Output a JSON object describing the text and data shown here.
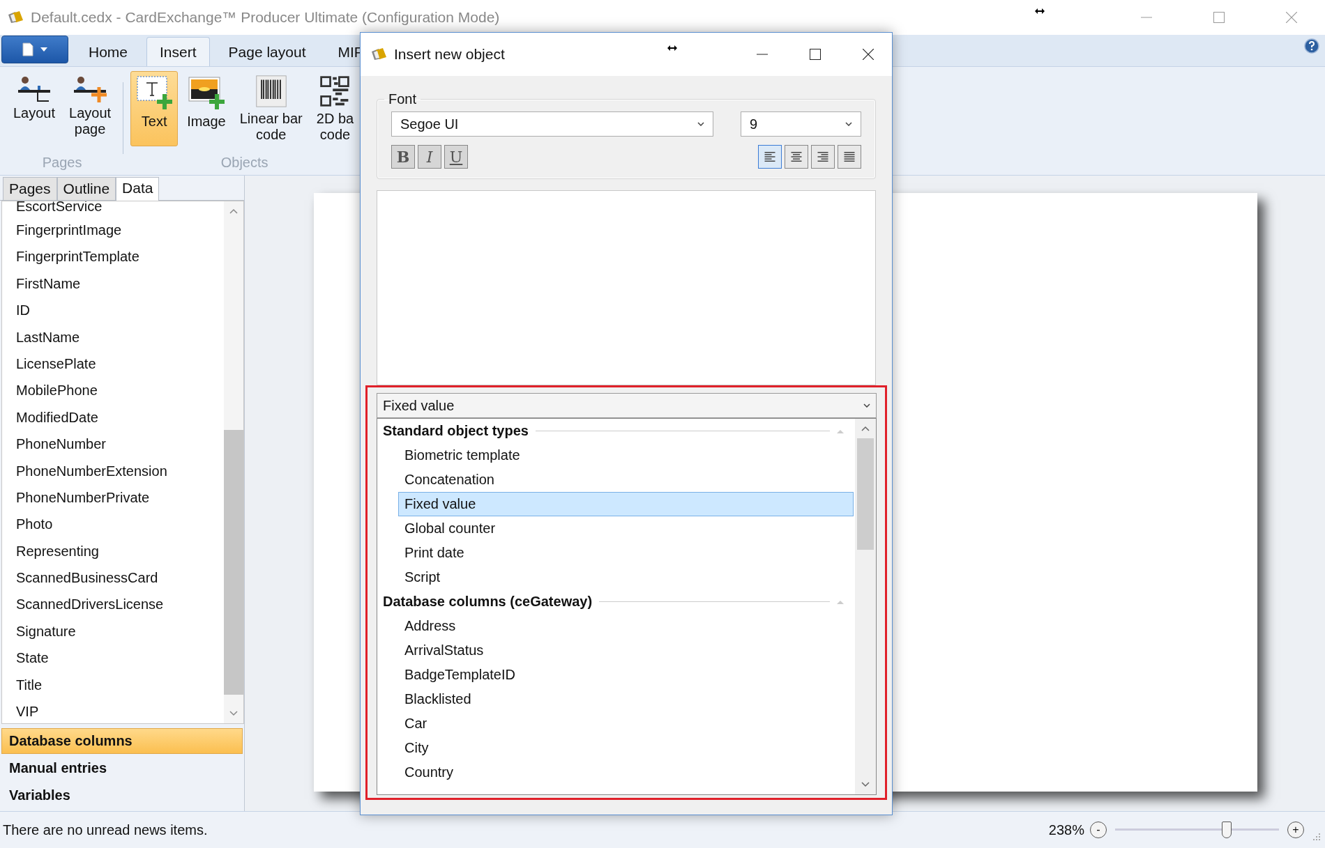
{
  "window": {
    "title": "Default.cedx - CardExchange™ Producer Ultimate (Configuration Mode)"
  },
  "ribbon_tabs": [
    {
      "label": "Home",
      "selected": false
    },
    {
      "label": "Insert",
      "selected": true
    },
    {
      "label": "Page layout",
      "selected": false
    },
    {
      "label": "MIF",
      "selected": false
    }
  ],
  "ribbon_groups": [
    {
      "title": "Pages",
      "buttons": [
        {
          "kind": "layout",
          "lines": [
            "Layout"
          ],
          "selected": false
        },
        {
          "kind": "layout_page",
          "lines": [
            "Layout",
            "page"
          ],
          "selected": false
        }
      ]
    },
    {
      "title": "Objects",
      "buttons": [
        {
          "kind": "text",
          "lines": [
            "Text"
          ],
          "selected": true
        },
        {
          "kind": "image",
          "lines": [
            "Image"
          ],
          "selected": false
        },
        {
          "kind": "barcode",
          "lines": [
            "Linear bar",
            "code"
          ],
          "selected": false
        },
        {
          "kind": "qr",
          "lines": [
            "2D ba",
            "code"
          ],
          "selected": false
        }
      ]
    }
  ],
  "panel_tabs": [
    {
      "label": "Pages",
      "selected": false
    },
    {
      "label": "Outline",
      "selected": false
    },
    {
      "label": "Data",
      "selected": true
    }
  ],
  "data_fields": [
    "EscortService",
    "FingerprintImage",
    "FingerprintTemplate",
    "FirstName",
    "ID",
    "LastName",
    "LicensePlate",
    "MobilePhone",
    "ModifiedDate",
    "PhoneNumber",
    "PhoneNumberExtension",
    "PhoneNumberPrivate",
    "Photo",
    "Representing",
    "ScannedBusinessCard",
    "ScannedDriversLicense",
    "Signature",
    "State",
    "Title",
    "VIP"
  ],
  "panel_sections": [
    {
      "label": "Database columns",
      "selected": true
    },
    {
      "label": "Manual entries",
      "selected": false
    },
    {
      "label": "Variables",
      "selected": false
    }
  ],
  "status_bar": {
    "message": "There are no unread news items.",
    "zoom": "238%",
    "zoom_out": "-",
    "zoom_in": "+",
    "level": 0.68
  },
  "dialog": {
    "title": "Insert new object",
    "font_group": "Font",
    "font_name": "Segoe UI",
    "font_size": "9",
    "style_buttons": [
      {
        "kind": "bold",
        "label": "B",
        "selected": false
      },
      {
        "kind": "italic",
        "label": "I",
        "selected": false
      },
      {
        "kind": "underline",
        "label": "U",
        "selected": false
      }
    ],
    "align_buttons": [
      {
        "kind": "left",
        "selected": true
      },
      {
        "kind": "center",
        "selected": false
      },
      {
        "kind": "right",
        "selected": false
      },
      {
        "kind": "justify",
        "selected": false
      }
    ],
    "object_type": "Fixed value",
    "groups": [
      {
        "title": "Standard object types",
        "items": [
          {
            "label": "Biometric template",
            "selected": false
          },
          {
            "label": "Concatenation",
            "selected": false
          },
          {
            "label": "Fixed value",
            "selected": true
          },
          {
            "label": "Global counter",
            "selected": false
          },
          {
            "label": "Print date",
            "selected": false
          },
          {
            "label": "Script",
            "selected": false
          }
        ]
      },
      {
        "title": "Database columns (ceGateway)",
        "items": [
          {
            "label": "Address",
            "selected": false
          },
          {
            "label": "ArrivalStatus",
            "selected": false
          },
          {
            "label": "BadgeTemplateID",
            "selected": false
          },
          {
            "label": "Blacklisted",
            "selected": false
          },
          {
            "label": "Car",
            "selected": false
          },
          {
            "label": "City",
            "selected": false
          },
          {
            "label": "Country",
            "selected": false
          }
        ]
      }
    ]
  }
}
